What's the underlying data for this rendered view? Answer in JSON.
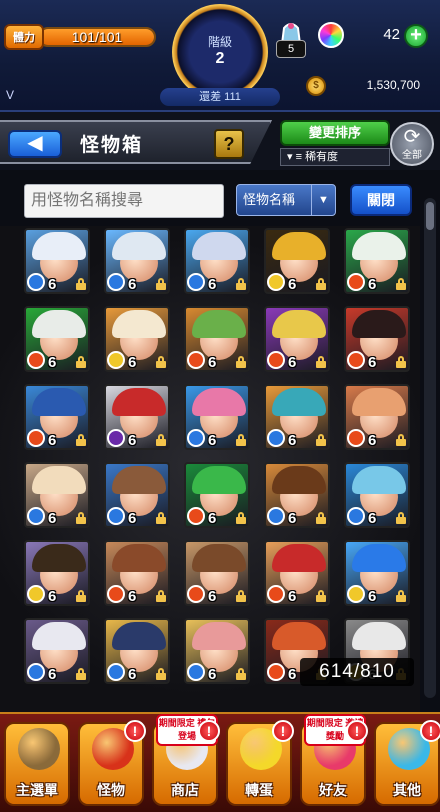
{
  "status": {
    "stamina_label": "體力",
    "stamina_text": "101/101",
    "stamina_fraction": 1.0,
    "rank_label": "階級",
    "rank_value": "2",
    "rank_gap": "還差 111",
    "bag_count": "5",
    "orb_count": "42",
    "plus_label": "+",
    "coin_symbol": "$",
    "coin_count": "1,530,700",
    "v_label": "V"
  },
  "header": {
    "back_glyph": "◀",
    "title": "怪物箱",
    "help_label": "?",
    "sort_button": "變更排序",
    "sort_field": "稀有度",
    "all_label": "全部",
    "all_glyph": "⟳"
  },
  "search": {
    "placeholder": "用怪物名稱搜尋",
    "filter_label": "怪物名稱",
    "filter_caret": "▼",
    "close_button": "關閉"
  },
  "monsters": {
    "level_text": "6",
    "rows": [
      [
        {
          "element": "water",
          "hair": "#e8eef8",
          "bg": "#5aa0e0"
        },
        {
          "element": "water",
          "hair": "#dfe8f2",
          "bg": "#6ab8ff"
        },
        {
          "element": "water",
          "hair": "#cfd8ee",
          "bg": "#4aa8f0"
        },
        {
          "element": "light",
          "hair": "#e8b02a",
          "bg": "#3a2a10"
        },
        {
          "element": "fire",
          "hair": "#eaf2ea",
          "bg": "#2aa84a"
        }
      ],
      [
        {
          "element": "fire",
          "hair": "#e8ece8",
          "bg": "#28a838"
        },
        {
          "element": "light",
          "hair": "#f4e8d0",
          "bg": "#e89a3a"
        },
        {
          "element": "fire",
          "hair": "#6ab04a",
          "bg": "#d88a30"
        },
        {
          "element": "fire",
          "hair": "#e8c84a",
          "bg": "#8a3ab8"
        },
        {
          "element": "fire",
          "hair": "#2a1a1a",
          "bg": "#c83a2a"
        }
      ],
      [
        {
          "element": "fire",
          "hair": "#2a5ab0",
          "bg": "#3a88d8"
        },
        {
          "element": "dark",
          "hair": "#c82a2a",
          "bg": "#d8d8e0"
        },
        {
          "element": "water",
          "hair": "#e878a8",
          "bg": "#3a98e8"
        },
        {
          "element": "water",
          "hair": "#38a8b8",
          "bg": "#e89a3a"
        },
        {
          "element": "fire",
          "hair": "#e8a070",
          "bg": "#d87a4a"
        }
      ],
      [
        {
          "element": "water",
          "hair": "#f2dcbc",
          "bg": "#c8a888"
        },
        {
          "element": "water",
          "hair": "#8a5a3a",
          "bg": "#3a78c8"
        },
        {
          "element": "fire",
          "hair": "#3ab84a",
          "bg": "#1a8a3a"
        },
        {
          "element": "water",
          "hair": "#6a3a1a",
          "bg": "#d88a3a"
        },
        {
          "element": "water",
          "hair": "#78c8e8",
          "bg": "#2a88d8"
        }
      ],
      [
        {
          "element": "light",
          "hair": "#3a2a1a",
          "bg": "#8a78b8"
        },
        {
          "element": "fire",
          "hair": "#8a4a2a",
          "bg": "#c88a5a"
        },
        {
          "element": "fire",
          "hair": "#7a4a2a",
          "bg": "#c89868"
        },
        {
          "element": "fire",
          "hair": "#c82a2a",
          "bg": "#e8a05a"
        },
        {
          "element": "light",
          "hair": "#2a7ae8",
          "bg": "#48a8f8"
        }
      ],
      [
        {
          "element": "water",
          "hair": "#e8e8f0",
          "bg": "#6a5a8a"
        },
        {
          "element": "water",
          "hair": "#2a3a6a",
          "bg": "#e8b84a"
        },
        {
          "element": "water",
          "hair": "#e89a9a",
          "bg": "#e8c05a"
        },
        {
          "element": "fire",
          "hair": "#d85a2a",
          "bg": "#8a2a1a"
        },
        {
          "element": "light",
          "hair": "#e8e8e8",
          "bg": "#8a8a8a"
        }
      ]
    ]
  },
  "element_colors": {
    "water": "#2a78e0",
    "fire": "#e84a1a",
    "light": "#f0c82a",
    "dark": "#6a2aa8"
  },
  "count_text": "614/810",
  "nav": {
    "items": [
      {
        "label": "主選單",
        "color": "#8a6a3a",
        "badge": ""
      },
      {
        "label": "怪物",
        "color": "#d8321a",
        "badge": "!"
      },
      {
        "label": "商店",
        "color": "#e8e8f0",
        "badge": "!",
        "promo": "期間限定 禮包登場"
      },
      {
        "label": "轉蛋",
        "color": "#f4d82a",
        "badge": "!"
      },
      {
        "label": "好友",
        "color": "#e83a6a",
        "badge": "!",
        "promo": "期間限定 邀請獎勵"
      },
      {
        "label": "其他",
        "color": "#3ab8e8",
        "badge": "!"
      }
    ]
  }
}
